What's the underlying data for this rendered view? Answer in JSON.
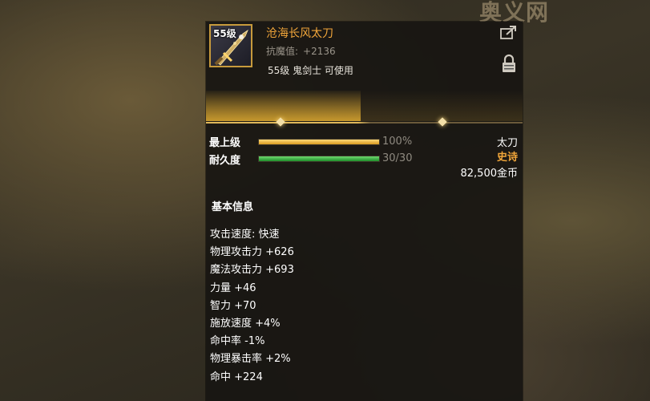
{
  "watermark": "奥义网",
  "item": {
    "icon": "katana-weapon-icon",
    "level_badge": "55级",
    "name": "沧海长风太刀",
    "anti_magic_label": "抗魔值:",
    "anti_magic_value": "+2136",
    "requirement": "55级 鬼剑士 可使用"
  },
  "stats": {
    "upgrade_label": "最上级",
    "upgrade_value": "100%",
    "upgrade_fraction": 1.0,
    "durability_label": "耐久度",
    "durability_value": "30/30",
    "durability_fraction": 1.0
  },
  "meta": {
    "weapon_type": "太刀",
    "rarity": "史诗",
    "price": "82,500金币"
  },
  "basic_info": {
    "title": "基本信息",
    "attributes": [
      "攻击速度: 快速",
      "物理攻击力 +626",
      "魔法攻击力 +693",
      "力量 +46",
      "智力 +70",
      "施放速度 +4%",
      "命中率 -1%",
      "物理暴击率 +2%",
      "命中 +224"
    ]
  },
  "colors": {
    "epic": "#f0a53a",
    "gold_bar": "#e0a22a",
    "green_bar": "#2fb03a"
  }
}
